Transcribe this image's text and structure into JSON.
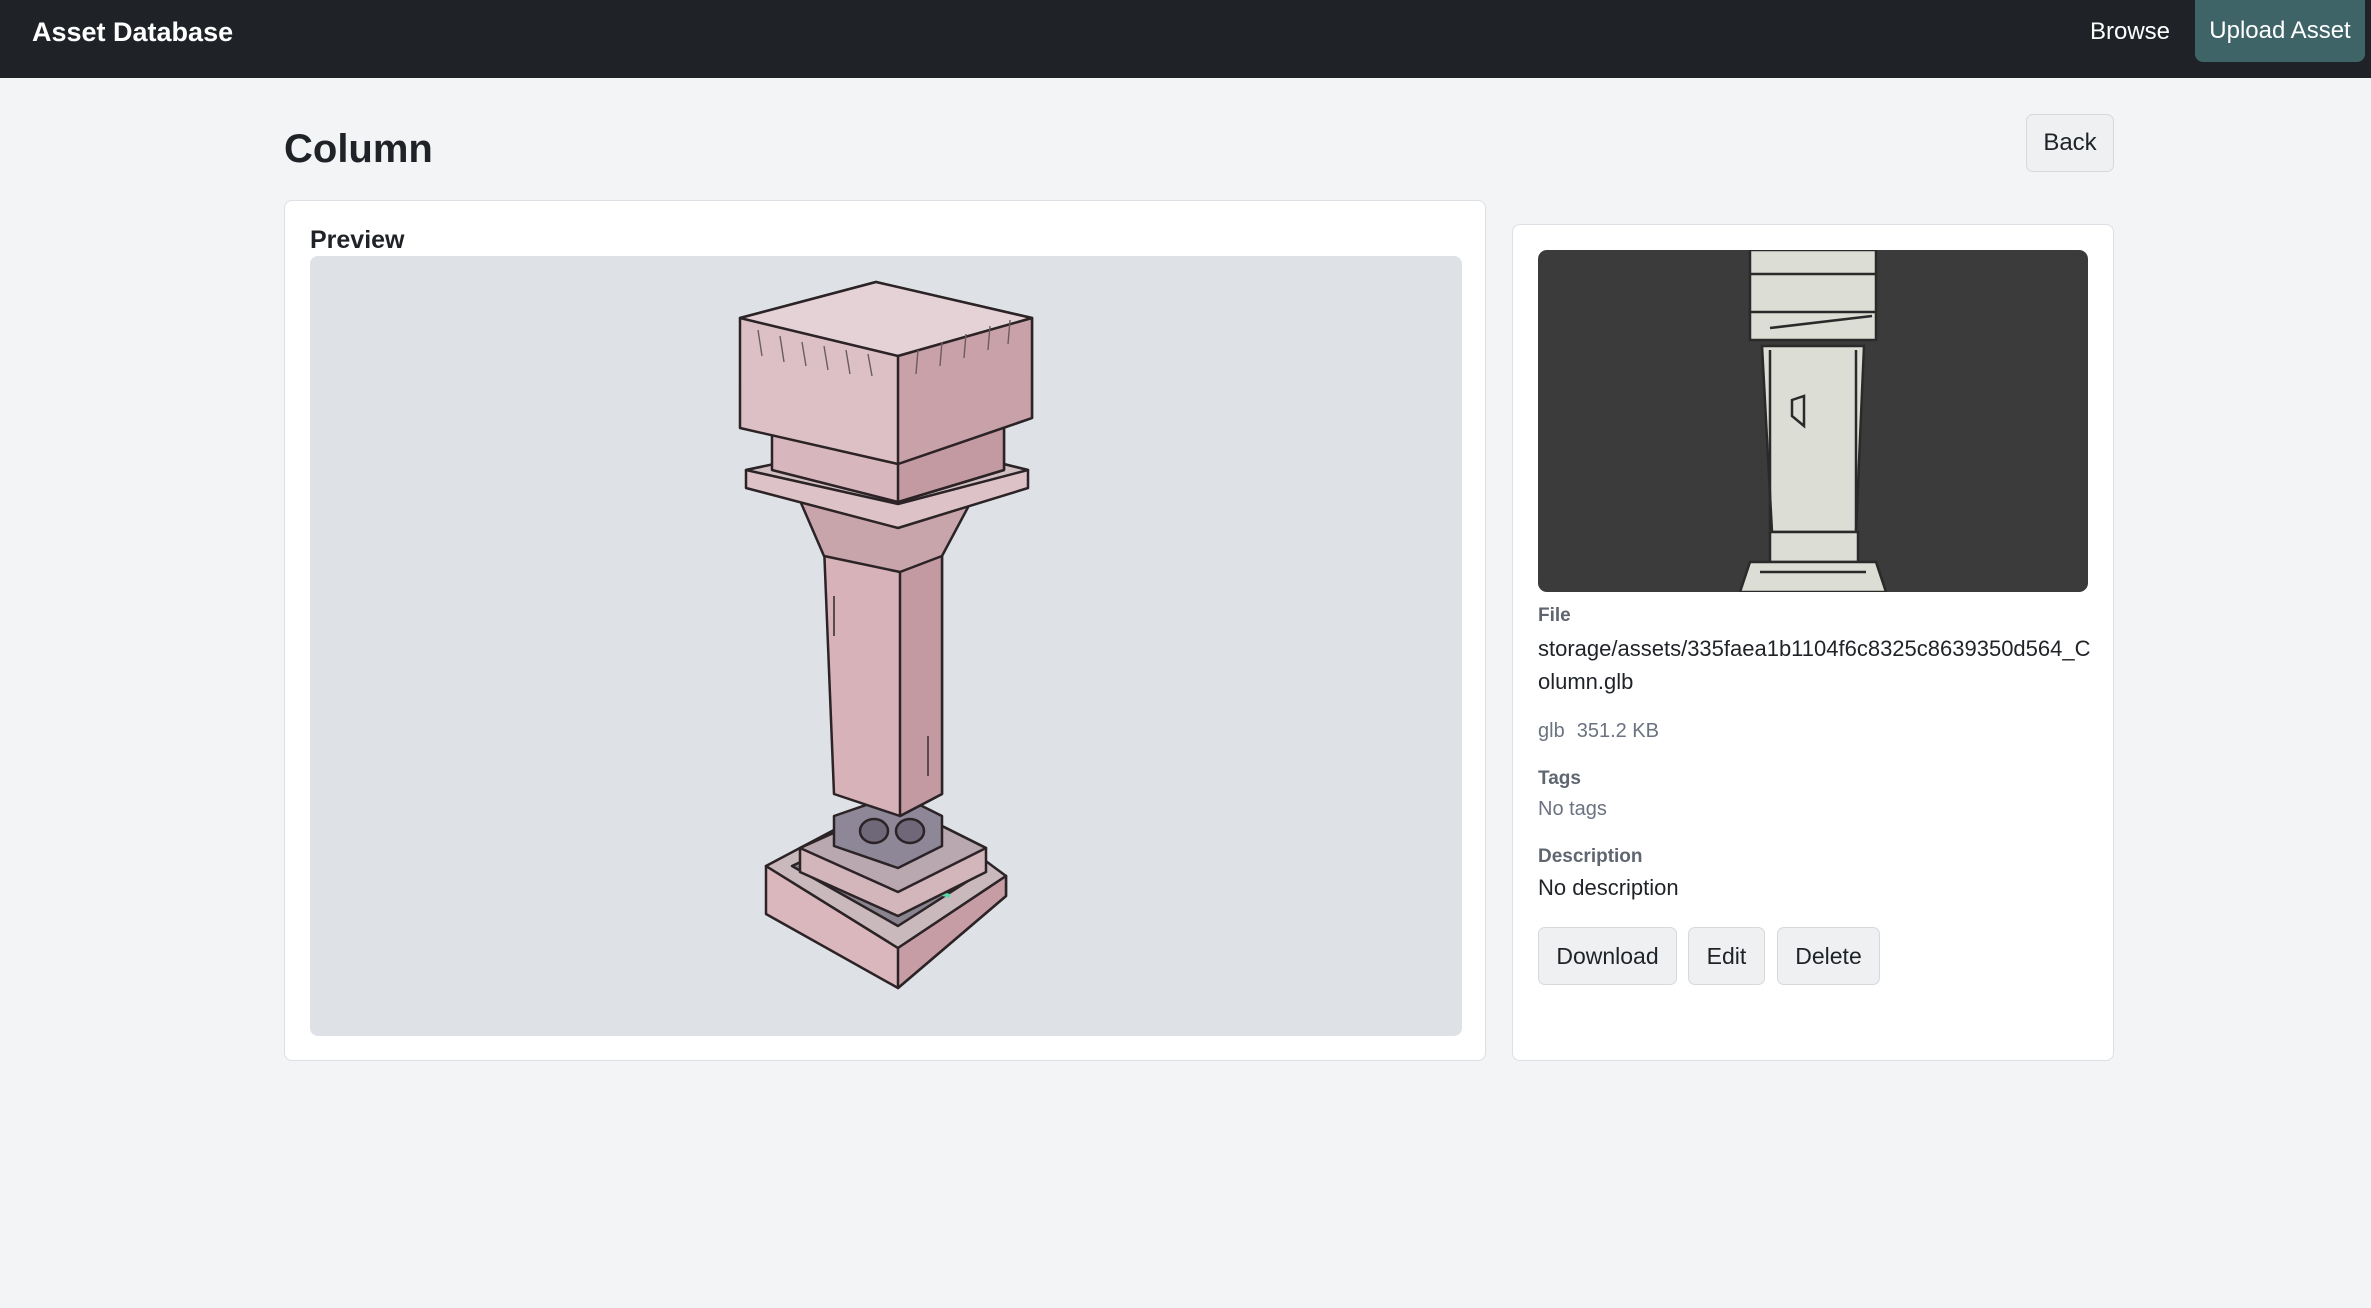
{
  "header": {
    "app_title": "Asset Database",
    "nav_browse": "Browse",
    "nav_upload": "Upload Asset"
  },
  "page": {
    "title": "Column",
    "back_label": "Back"
  },
  "preview": {
    "label": "Preview"
  },
  "details": {
    "file_label": "File",
    "file_path": "storage/assets/335faea1b1104f6c8325c8639350d564_Column.glb",
    "format": "glb",
    "size": "351.2 KB",
    "tags_label": "Tags",
    "tags_value": "No tags",
    "description_label": "Description",
    "description_value": "No description"
  },
  "actions": {
    "download": "Download",
    "edit": "Edit",
    "delete": "Delete"
  },
  "colors": {
    "topbar": "#1f2328",
    "accent": "#3e6468",
    "column_fill": "#dfc3c8",
    "viewport_bg": "#dee1e5",
    "thumb_bg": "#3b3b3b"
  },
  "icons": {
    "preview_model": "column-3d-model",
    "thumbnail": "column-thumbnail"
  }
}
